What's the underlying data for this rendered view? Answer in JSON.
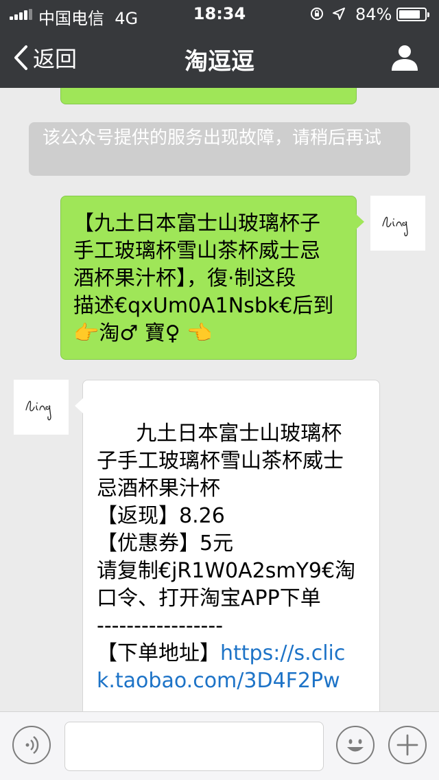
{
  "status_bar": {
    "carrier": "中国电信",
    "network": "4G",
    "time": "18:34",
    "battery_percent": "84%",
    "battery_level": 0.84
  },
  "nav": {
    "back_label": "返回",
    "title": "淘逗逗",
    "profile_icon": "person-icon"
  },
  "chat": {
    "system_message": "该公众号提供的服务出现故障，请稍后再试",
    "outgoing": {
      "avatar_text": "ling",
      "lines": [
        "【九土日本富士山玻璃杯子",
        "手工玻璃杯雪山茶杯威士忌",
        "酒杯果汁杯】，復·制这段",
        "描述€qxUm0A1Nsbk€后到",
        "👉淘♂ 寶♀ 👈"
      ]
    },
    "incoming": {
      "avatar_text": "ling",
      "lines": [
        "      九土日本富士山玻璃杯",
        "子手工玻璃杯雪山茶杯威士",
        "忌酒杯果汁杯",
        "【返现】8.26",
        "【优惠券】5元",
        "请复制€jR1W0A2smY9€淘",
        "口令、打开淘宝APP下单",
        "-----------------"
      ],
      "address_label": "【下单地址】",
      "link_part1": "https://s.clic",
      "link_part2": "k.taobao.com/3D4F2Pw"
    }
  },
  "input_bar": {
    "voice_icon": "voice-icon",
    "emoji_icon": "emoji-icon",
    "plus_icon": "plus-icon",
    "text_value": ""
  },
  "colors": {
    "nav_bg": "#37393c",
    "chat_bg": "#ebebeb",
    "outgoing_bubble": "#9fe658",
    "system_bubble": "#cecece",
    "link": "#1d73c7"
  }
}
